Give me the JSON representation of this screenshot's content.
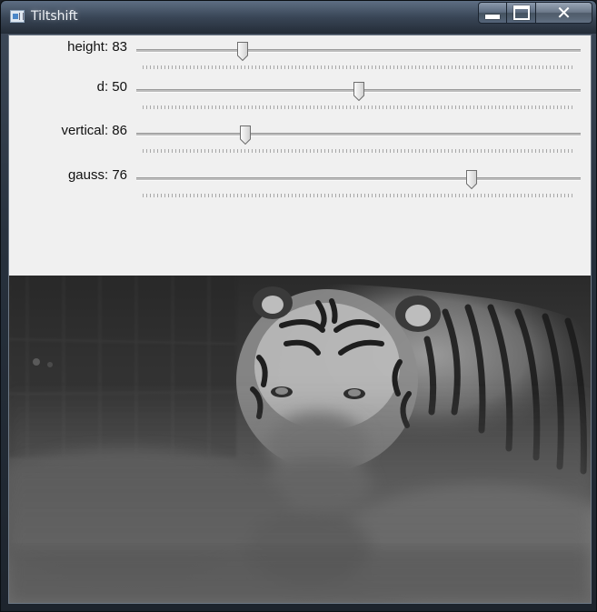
{
  "window": {
    "title": "Tiltshift",
    "buttons": {
      "minimize": "minimize",
      "maximize": "maximize",
      "close": "close"
    }
  },
  "sliders": [
    {
      "name": "height",
      "label": "height: 83",
      "value": 83,
      "max": 350,
      "position_fraction": 0.24
    },
    {
      "name": "d",
      "label": "d: 50",
      "value": 50,
      "max": 100,
      "position_fraction": 0.5
    },
    {
      "name": "vertical",
      "label": "vertical: 86",
      "value": 86,
      "max": 350,
      "position_fraction": 0.245
    },
    {
      "name": "gauss",
      "label": "gauss: 76",
      "value": 76,
      "max": 100,
      "position_fraction": 0.755
    }
  ],
  "image": {
    "subject": "tiger-photo"
  },
  "icons": [
    "app-icon",
    "minimize-icon",
    "maximize-icon",
    "close-icon"
  ],
  "colors": {
    "panel": "#f0f0f0",
    "track": "#bdbdbd",
    "titlebar": "#3e4a5a"
  }
}
